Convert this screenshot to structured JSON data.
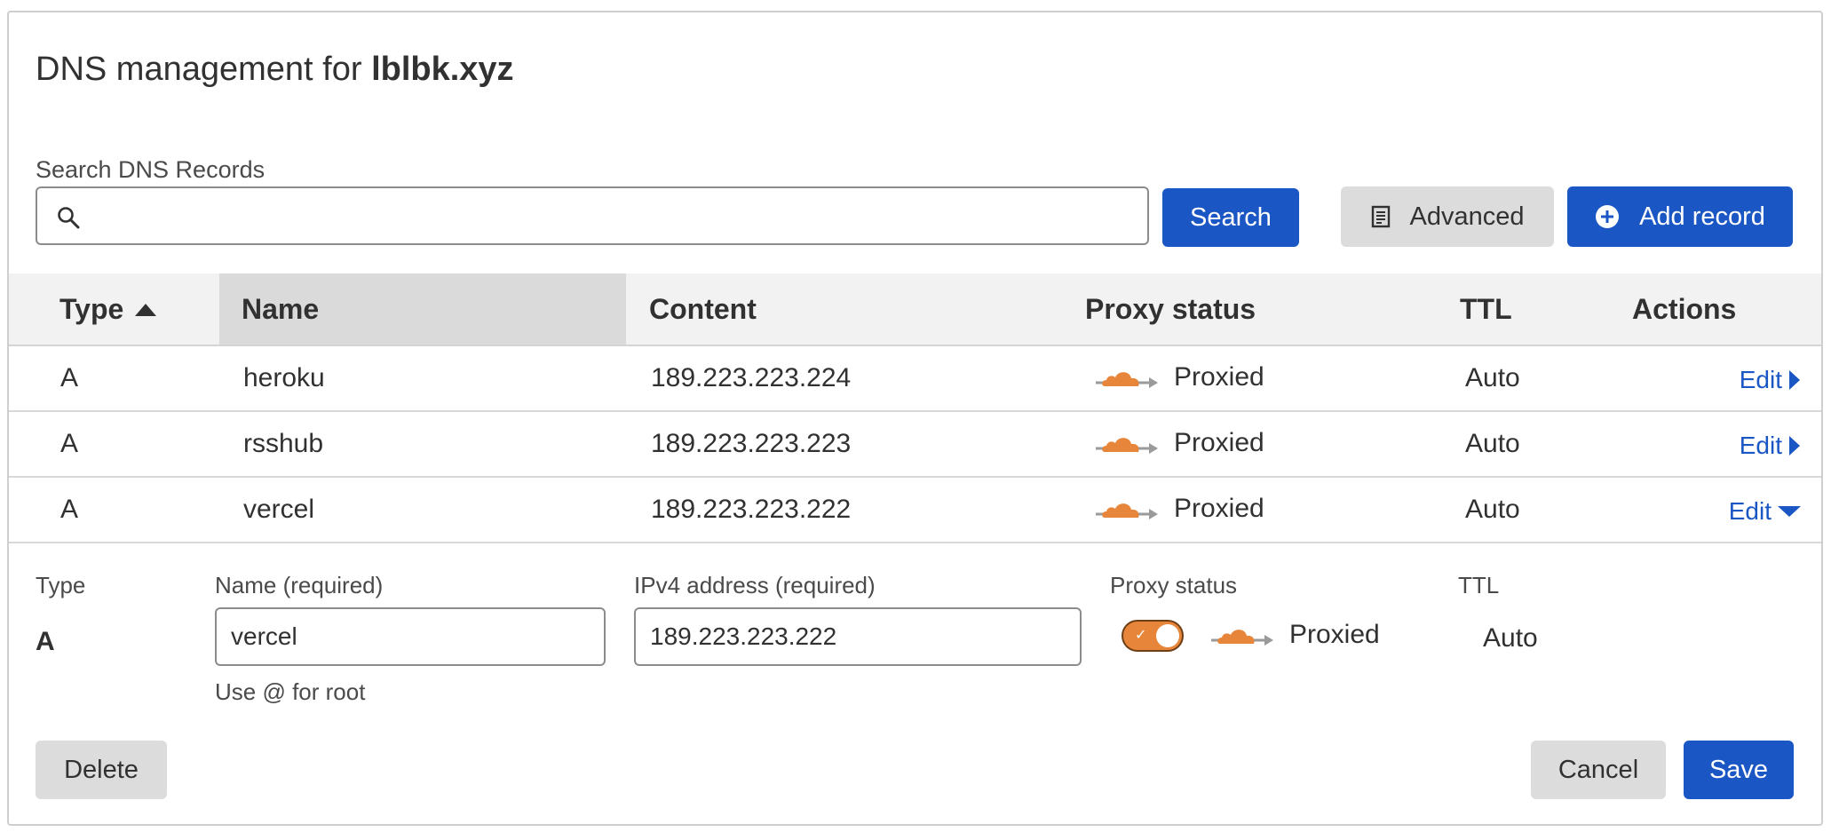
{
  "page": {
    "title_prefix": "DNS management for ",
    "domain": "lblbk.xyz"
  },
  "search": {
    "label": "Search DNS Records",
    "value": "",
    "placeholder": "",
    "button": "Search"
  },
  "toolbar": {
    "advanced": "Advanced",
    "add_record": "Add record"
  },
  "table": {
    "headers": {
      "type": "Type",
      "name": "Name",
      "content": "Content",
      "proxy_status": "Proxy status",
      "ttl": "TTL",
      "actions": "Actions"
    },
    "sort": {
      "column": "Type",
      "direction": "ascending"
    },
    "rows": [
      {
        "type": "A",
        "name": "heroku",
        "content": "189.223.223.224",
        "proxy": "Proxied",
        "ttl": "Auto",
        "action": "Edit",
        "expanded": false
      },
      {
        "type": "A",
        "name": "rsshub",
        "content": "189.223.223.223",
        "proxy": "Proxied",
        "ttl": "Auto",
        "action": "Edit",
        "expanded": false
      },
      {
        "type": "A",
        "name": "vercel",
        "content": "189.223.223.222",
        "proxy": "Proxied",
        "ttl": "Auto",
        "action": "Edit",
        "expanded": true
      }
    ]
  },
  "edit_form": {
    "type_label": "Type",
    "type_value": "A",
    "name_label": "Name (required)",
    "name_value": "vercel",
    "name_hint": "Use @ for root",
    "ipv4_label": "IPv4 address (required)",
    "ipv4_value": "189.223.223.222",
    "proxy_label": "Proxy status",
    "proxy_on": true,
    "proxy_value": "Proxied",
    "ttl_label": "TTL",
    "ttl_value": "Auto",
    "delete": "Delete",
    "cancel": "Cancel",
    "save": "Save"
  },
  "colors": {
    "primary": "#1a56c4",
    "cloud": "#e7863a",
    "secondary_button": "#dcdcdc"
  }
}
